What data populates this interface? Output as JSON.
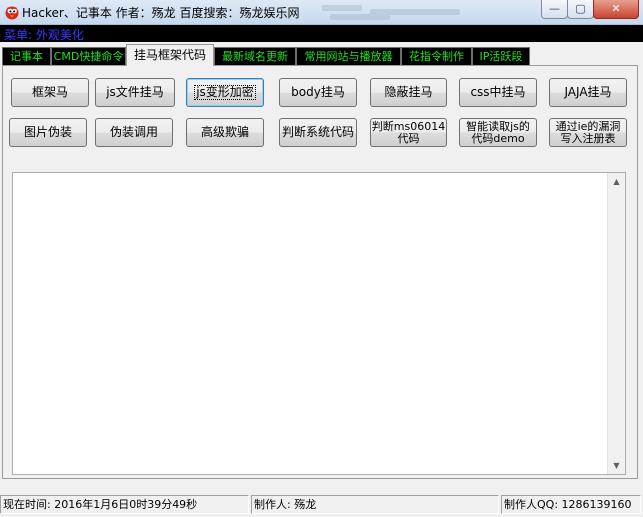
{
  "window": {
    "title": "Hacker、记事本  作者：殇龙  百度搜索：殇龙娱乐网",
    "min_glyph": "—",
    "max_glyph": "▢",
    "close_glyph": "✕",
    "app_icon": "red-bird-icon"
  },
  "menu": {
    "label": "菜单: 外观美化"
  },
  "tabs": [
    {
      "label": "记事本",
      "active": false
    },
    {
      "label": "CMD快捷命令",
      "active": false
    },
    {
      "label": "挂马框架代码",
      "active": true
    },
    {
      "label": "最新域名更新",
      "active": false
    },
    {
      "label": "常用网站与播放器",
      "active": false
    },
    {
      "label": "花指令制作",
      "active": false
    },
    {
      "label": "IP活跃段",
      "active": false
    }
  ],
  "buttons": {
    "row1": [
      "框架马",
      "js文件挂马",
      "js变形加密",
      "body挂马",
      "隐蔽挂马",
      "css中挂马",
      "JAJA挂马"
    ],
    "row2": [
      "图片伪装",
      "伪装调用",
      "高级欺骗",
      "判断系统代码",
      "判断ms06014\n代码",
      "智能读取js的\n代码demo",
      "通过ie的漏洞\n写入注册表"
    ]
  },
  "editor": {
    "value": ""
  },
  "status": {
    "time": "现在时间: 2016年1月6日0时39分49秒",
    "author": "制作人: 殇龙",
    "qq": "制作人QQ: 1286139160"
  },
  "colors": {
    "tab_text": "#22e022",
    "tab_bg": "#000000",
    "menu_text": "#3a3aff"
  }
}
